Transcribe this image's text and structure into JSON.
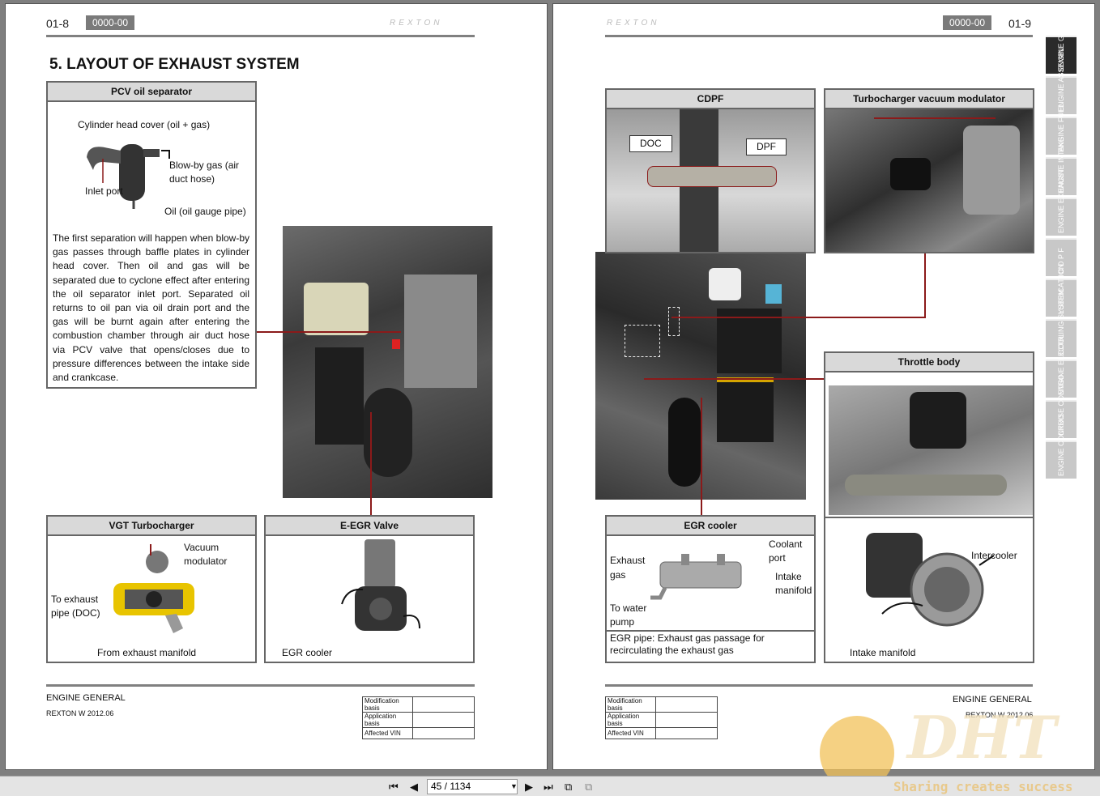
{
  "left_page": {
    "page_number": "01-8",
    "code": "0000-00",
    "brand": "REXTON",
    "title": "5. LAYOUT OF EXHAUST SYSTEM",
    "pcv": {
      "heading": "PCV oil separator",
      "label_cover": "Cylinder head cover (oil + gas)",
      "label_blowby_1": "Blow-by gas (air",
      "label_blowby_2": "duct hose)",
      "label_inlet": "Inlet port",
      "label_oil": "Oil (oil gauge pipe)",
      "description": "The first separation will happen when blow-by gas passes through baffle plates in cylinder head cover. Then oil and gas will be separated due to cyclone effect after entering the oil separator inlet port. Separated oil returns to oil pan via oil drain port and the gas will be burnt again after entering the combustion chamber through air duct hose via PCV valve that opens/closes due to pressure differences between the intake side and crankcase."
    },
    "vgt": {
      "heading": "VGT Turbocharger",
      "label_vacuum_1": "Vacuum",
      "label_vacuum_2": "modulator",
      "label_exhaust_1": "To exhaust",
      "label_exhaust_2": "pipe (DOC)",
      "label_manifold": "From exhaust manifold"
    },
    "egr_valve": {
      "heading": "E-EGR Valve",
      "label_cooler": "EGR cooler"
    },
    "footer": {
      "title": "ENGINE GENERAL",
      "subtitle": "REXTON W 2012.06",
      "rows": [
        "Modification basis",
        "Application basis",
        "Affected VIN"
      ]
    }
  },
  "right_page": {
    "page_number": "01-9",
    "code": "0000-00",
    "brand": "REXTON",
    "cdpf": {
      "heading": "CDPF",
      "label_doc": "DOC",
      "label_dpf": "DPF"
    },
    "turbo_vac": {
      "heading": "Turbocharger vacuum modulator"
    },
    "throttle": {
      "heading": "Throttle body",
      "label_intercooler": "Intercooler",
      "label_intake": "Intake manifold"
    },
    "egr_cooler": {
      "heading": "EGR cooler",
      "label_exhaust_1": "Exhaust",
      "label_exhaust_2": "gas",
      "label_coolant_1": "Coolant",
      "label_coolant_2": "port",
      "label_intake_1": "Intake",
      "label_intake_2": "manifold",
      "label_water_1": "To water",
      "label_water_2": "pump",
      "note": "EGR pipe: Exhaust gas passage for recirculating the exhaust gas"
    },
    "footer": {
      "title": "ENGINE GENERAL",
      "subtitle": "REXTON W 2012.06",
      "rows": [
        "Modification basis",
        "Application basis",
        "Affected VIN"
      ]
    }
  },
  "side_tabs": [
    {
      "label": "ENGINE GENERAL",
      "active": true
    },
    {
      "label": "ENGINE ASSEMBL",
      "active": false
    },
    {
      "label": "ENGINE FUEL",
      "active": false
    },
    {
      "label": "ENGINE INTAKE",
      "active": false
    },
    {
      "label": "ENGINE EXHAUST",
      "active": false
    },
    {
      "label": "C D P F",
      "active": false
    },
    {
      "label": "LUBRICAT ION",
      "active": false
    },
    {
      "label": "COOLING SYSTEM",
      "active": false
    },
    {
      "label": "ENGINE ELECTRI",
      "active": false
    },
    {
      "label": "CRUISE CONTRO",
      "active": false
    },
    {
      "label": "ENGINE CONTRO",
      "active": false
    }
  ],
  "toolbar": {
    "page_indicator": "45 / 1134",
    "icons": [
      "first-page-icon",
      "prev-page-icon",
      "next-page-icon",
      "last-page-icon",
      "back-view-icon",
      "forward-view-icon"
    ]
  },
  "watermark": {
    "brand": "DHT",
    "slogan": "Sharing creates success"
  },
  "colors": {
    "callout_line": "#8b1a1a",
    "header_fill": "#d9d9d9",
    "tab_active": "#2a2a2a",
    "tab_inactive": "#c8c8c8"
  }
}
